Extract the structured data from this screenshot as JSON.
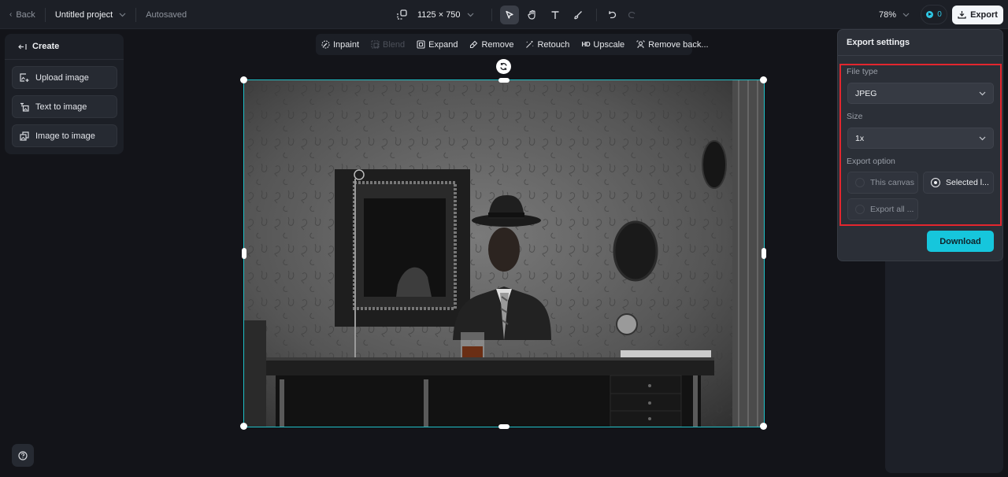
{
  "topbar": {
    "back_label": "Back",
    "project_title": "Untitled project",
    "save_status": "Autosaved",
    "canvas_dimensions": "1125 × 750",
    "tools": [
      {
        "name": "select",
        "icon": "pointer-icon",
        "active": true
      },
      {
        "name": "pan",
        "icon": "hand-icon",
        "active": false
      },
      {
        "name": "text",
        "icon": "text-icon",
        "active": false
      },
      {
        "name": "brush",
        "icon": "brush-icon",
        "active": false
      }
    ],
    "zoom_level": "78%",
    "credits": "0",
    "export_label": "Export"
  },
  "create_panel": {
    "title": "Create",
    "items": [
      {
        "label": "Upload image",
        "icon": "upload-image-icon"
      },
      {
        "label": "Text to image",
        "icon": "text-to-image-icon"
      },
      {
        "label": "Image to image",
        "icon": "image-to-image-icon"
      }
    ]
  },
  "edit_toolbar": {
    "items": [
      {
        "label": "Inpaint",
        "icon": "inpaint-icon",
        "enabled": true
      },
      {
        "label": "Blend",
        "icon": "blend-icon",
        "enabled": false
      },
      {
        "label": "Expand",
        "icon": "expand-icon",
        "enabled": true
      },
      {
        "label": "Remove",
        "icon": "eraser-icon",
        "enabled": true
      },
      {
        "label": "Retouch",
        "icon": "magic-wand-icon",
        "enabled": true
      },
      {
        "label": "Upscale",
        "icon": "hd-icon",
        "icon_text": "HD",
        "enabled": true
      },
      {
        "label": "Remove back...",
        "icon": "remove-background-icon",
        "enabled": true
      }
    ]
  },
  "canvas": {
    "image_description": "Black and white photo of a man in a fedora and suit seated at a desk with a glass of whiskey, ornate wallpaper and framed mirror behind",
    "accent_color": "#1fbfc6"
  },
  "export_settings": {
    "title": "Export settings",
    "file_type_label": "File type",
    "file_type_value": "JPEG",
    "size_label": "Size",
    "size_value": "1x",
    "export_option_label": "Export option",
    "options": [
      {
        "label": "This canvas",
        "selected": false
      },
      {
        "label": "Selected l...",
        "selected": true
      },
      {
        "label": "Export all ...",
        "selected": false
      }
    ],
    "download_label": "Download",
    "highlight_color": "#e3262e",
    "download_color": "#16c6dc"
  }
}
